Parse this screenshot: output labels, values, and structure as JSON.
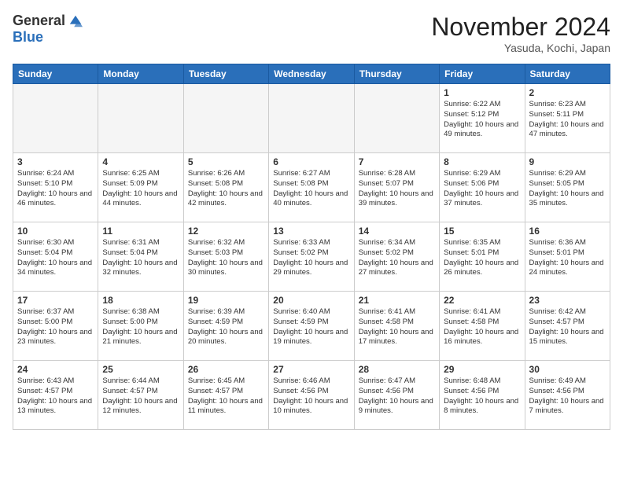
{
  "header": {
    "logo_general": "General",
    "logo_blue": "Blue",
    "month_title": "November 2024",
    "location": "Yasuda, Kochi, Japan"
  },
  "weekdays": [
    "Sunday",
    "Monday",
    "Tuesday",
    "Wednesday",
    "Thursday",
    "Friday",
    "Saturday"
  ],
  "weeks": [
    [
      {
        "day": "",
        "info": ""
      },
      {
        "day": "",
        "info": ""
      },
      {
        "day": "",
        "info": ""
      },
      {
        "day": "",
        "info": ""
      },
      {
        "day": "",
        "info": ""
      },
      {
        "day": "1",
        "info": "Sunrise: 6:22 AM\nSunset: 5:12 PM\nDaylight: 10 hours and 49 minutes."
      },
      {
        "day": "2",
        "info": "Sunrise: 6:23 AM\nSunset: 5:11 PM\nDaylight: 10 hours and 47 minutes."
      }
    ],
    [
      {
        "day": "3",
        "info": "Sunrise: 6:24 AM\nSunset: 5:10 PM\nDaylight: 10 hours and 46 minutes."
      },
      {
        "day": "4",
        "info": "Sunrise: 6:25 AM\nSunset: 5:09 PM\nDaylight: 10 hours and 44 minutes."
      },
      {
        "day": "5",
        "info": "Sunrise: 6:26 AM\nSunset: 5:08 PM\nDaylight: 10 hours and 42 minutes."
      },
      {
        "day": "6",
        "info": "Sunrise: 6:27 AM\nSunset: 5:08 PM\nDaylight: 10 hours and 40 minutes."
      },
      {
        "day": "7",
        "info": "Sunrise: 6:28 AM\nSunset: 5:07 PM\nDaylight: 10 hours and 39 minutes."
      },
      {
        "day": "8",
        "info": "Sunrise: 6:29 AM\nSunset: 5:06 PM\nDaylight: 10 hours and 37 minutes."
      },
      {
        "day": "9",
        "info": "Sunrise: 6:29 AM\nSunset: 5:05 PM\nDaylight: 10 hours and 35 minutes."
      }
    ],
    [
      {
        "day": "10",
        "info": "Sunrise: 6:30 AM\nSunset: 5:04 PM\nDaylight: 10 hours and 34 minutes."
      },
      {
        "day": "11",
        "info": "Sunrise: 6:31 AM\nSunset: 5:04 PM\nDaylight: 10 hours and 32 minutes."
      },
      {
        "day": "12",
        "info": "Sunrise: 6:32 AM\nSunset: 5:03 PM\nDaylight: 10 hours and 30 minutes."
      },
      {
        "day": "13",
        "info": "Sunrise: 6:33 AM\nSunset: 5:02 PM\nDaylight: 10 hours and 29 minutes."
      },
      {
        "day": "14",
        "info": "Sunrise: 6:34 AM\nSunset: 5:02 PM\nDaylight: 10 hours and 27 minutes."
      },
      {
        "day": "15",
        "info": "Sunrise: 6:35 AM\nSunset: 5:01 PM\nDaylight: 10 hours and 26 minutes."
      },
      {
        "day": "16",
        "info": "Sunrise: 6:36 AM\nSunset: 5:01 PM\nDaylight: 10 hours and 24 minutes."
      }
    ],
    [
      {
        "day": "17",
        "info": "Sunrise: 6:37 AM\nSunset: 5:00 PM\nDaylight: 10 hours and 23 minutes."
      },
      {
        "day": "18",
        "info": "Sunrise: 6:38 AM\nSunset: 5:00 PM\nDaylight: 10 hours and 21 minutes."
      },
      {
        "day": "19",
        "info": "Sunrise: 6:39 AM\nSunset: 4:59 PM\nDaylight: 10 hours and 20 minutes."
      },
      {
        "day": "20",
        "info": "Sunrise: 6:40 AM\nSunset: 4:59 PM\nDaylight: 10 hours and 19 minutes."
      },
      {
        "day": "21",
        "info": "Sunrise: 6:41 AM\nSunset: 4:58 PM\nDaylight: 10 hours and 17 minutes."
      },
      {
        "day": "22",
        "info": "Sunrise: 6:41 AM\nSunset: 4:58 PM\nDaylight: 10 hours and 16 minutes."
      },
      {
        "day": "23",
        "info": "Sunrise: 6:42 AM\nSunset: 4:57 PM\nDaylight: 10 hours and 15 minutes."
      }
    ],
    [
      {
        "day": "24",
        "info": "Sunrise: 6:43 AM\nSunset: 4:57 PM\nDaylight: 10 hours and 13 minutes."
      },
      {
        "day": "25",
        "info": "Sunrise: 6:44 AM\nSunset: 4:57 PM\nDaylight: 10 hours and 12 minutes."
      },
      {
        "day": "26",
        "info": "Sunrise: 6:45 AM\nSunset: 4:57 PM\nDaylight: 10 hours and 11 minutes."
      },
      {
        "day": "27",
        "info": "Sunrise: 6:46 AM\nSunset: 4:56 PM\nDaylight: 10 hours and 10 minutes."
      },
      {
        "day": "28",
        "info": "Sunrise: 6:47 AM\nSunset: 4:56 PM\nDaylight: 10 hours and 9 minutes."
      },
      {
        "day": "29",
        "info": "Sunrise: 6:48 AM\nSunset: 4:56 PM\nDaylight: 10 hours and 8 minutes."
      },
      {
        "day": "30",
        "info": "Sunrise: 6:49 AM\nSunset: 4:56 PM\nDaylight: 10 hours and 7 minutes."
      }
    ]
  ]
}
